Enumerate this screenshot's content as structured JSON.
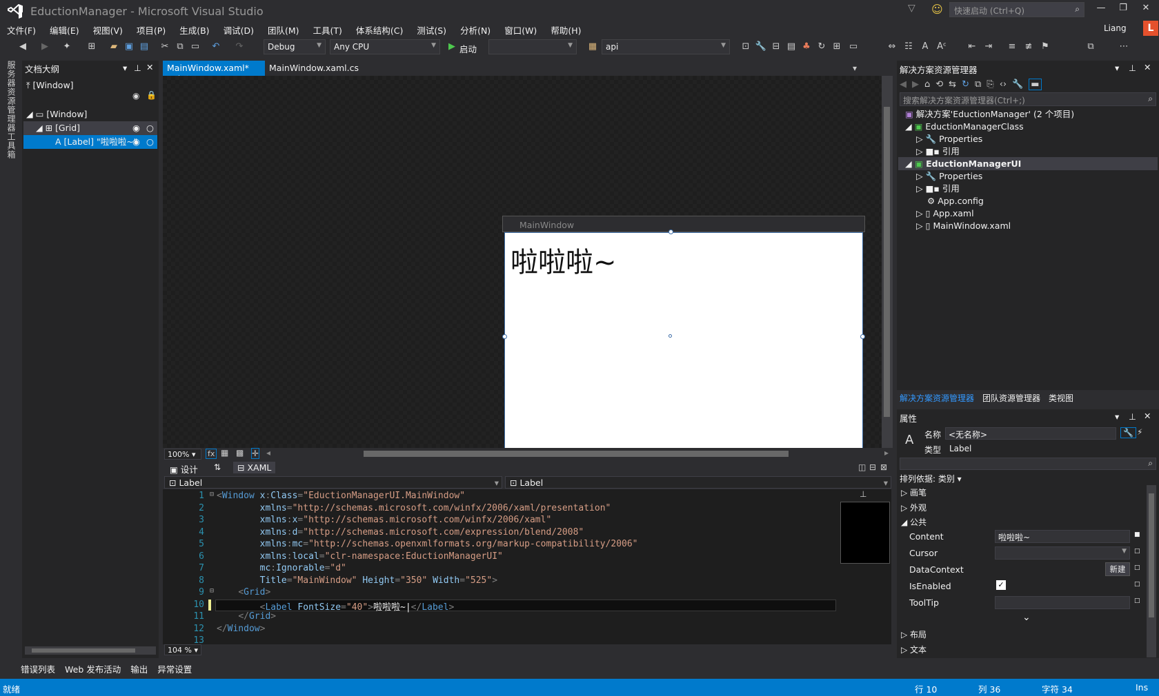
{
  "window": {
    "title": "EductionManager - Microsoft Visual Studio",
    "quick_launch": "快速启动 (Ctrl+Q)",
    "user": "Liang",
    "avatar": "L"
  },
  "menu": [
    "文件(F)",
    "编辑(E)",
    "视图(V)",
    "项目(P)",
    "生成(B)",
    "调试(D)",
    "团队(M)",
    "工具(T)",
    "体系结构(C)",
    "测试(S)",
    "分析(N)",
    "窗口(W)",
    "帮助(H)"
  ],
  "toolbar": {
    "config": "Debug",
    "platform": "Any CPU",
    "start": "启动",
    "project": "api"
  },
  "left_strip": {
    "tab1": "服务器资源管理器",
    "tab2": "工具箱"
  },
  "outline": {
    "title": "文档大纲",
    "crumb": "[Window]",
    "items": [
      "[Window]",
      "[Grid]",
      "[Label] \"啦啦啦~\""
    ]
  },
  "tabs": {
    "active": "MainWindow.xaml*",
    "other": "MainWindow.xaml.cs"
  },
  "designer": {
    "window_title": "MainWindow",
    "label_text": "啦啦啦~",
    "zoom": "100%"
  },
  "split": {
    "design": "设计",
    "xaml": "XAML"
  },
  "nav": {
    "left": "Label",
    "right": "Label"
  },
  "code": {
    "zoom": "104 %",
    "line_numbers": [
      "1",
      "2",
      "3",
      "4",
      "5",
      "6",
      "7",
      "8",
      "9",
      "10",
      "11",
      "12",
      "13"
    ]
  },
  "solution": {
    "title": "解决方案资源管理器",
    "search": "搜索解决方案资源管理器(Ctrl+;)",
    "items": [
      "解决方案'EductionManager' (2 个项目)",
      "EductionManagerClass",
      "Properties",
      "引用",
      "EductionManagerUI",
      "Properties",
      "引用",
      "App.config",
      "App.xaml",
      "MainWindow.xaml"
    ]
  },
  "panel_tabs": [
    "解决方案资源管理器",
    "团队资源管理器",
    "类视图"
  ],
  "properties": {
    "title": "属性",
    "name_label": "名称",
    "name_value": "<无名称>",
    "type_label": "类型",
    "type_value": "Label",
    "sort": "排列依据: 类别",
    "categories": [
      "画笔",
      "外观",
      "公共",
      "布局",
      "文本"
    ],
    "rows": [
      {
        "label": "Content",
        "value": "啦啦啦~"
      },
      {
        "label": "Cursor",
        "value": ""
      },
      {
        "label": "DataContext",
        "value": "新建"
      },
      {
        "label": "IsEnabled",
        "value": ""
      },
      {
        "label": "ToolTip",
        "value": ""
      }
    ]
  },
  "bottom_tabs": [
    "错误列表",
    "Web 发布活动",
    "输出",
    "异常设置"
  ],
  "status": {
    "ready": "就绪",
    "line": "行 10",
    "col": "列 36",
    "char": "字符 34",
    "mode": "Ins"
  },
  "colors": {
    "accent": "#007acc",
    "bg": "#2d2d30",
    "editor": "#1e1e1e"
  }
}
